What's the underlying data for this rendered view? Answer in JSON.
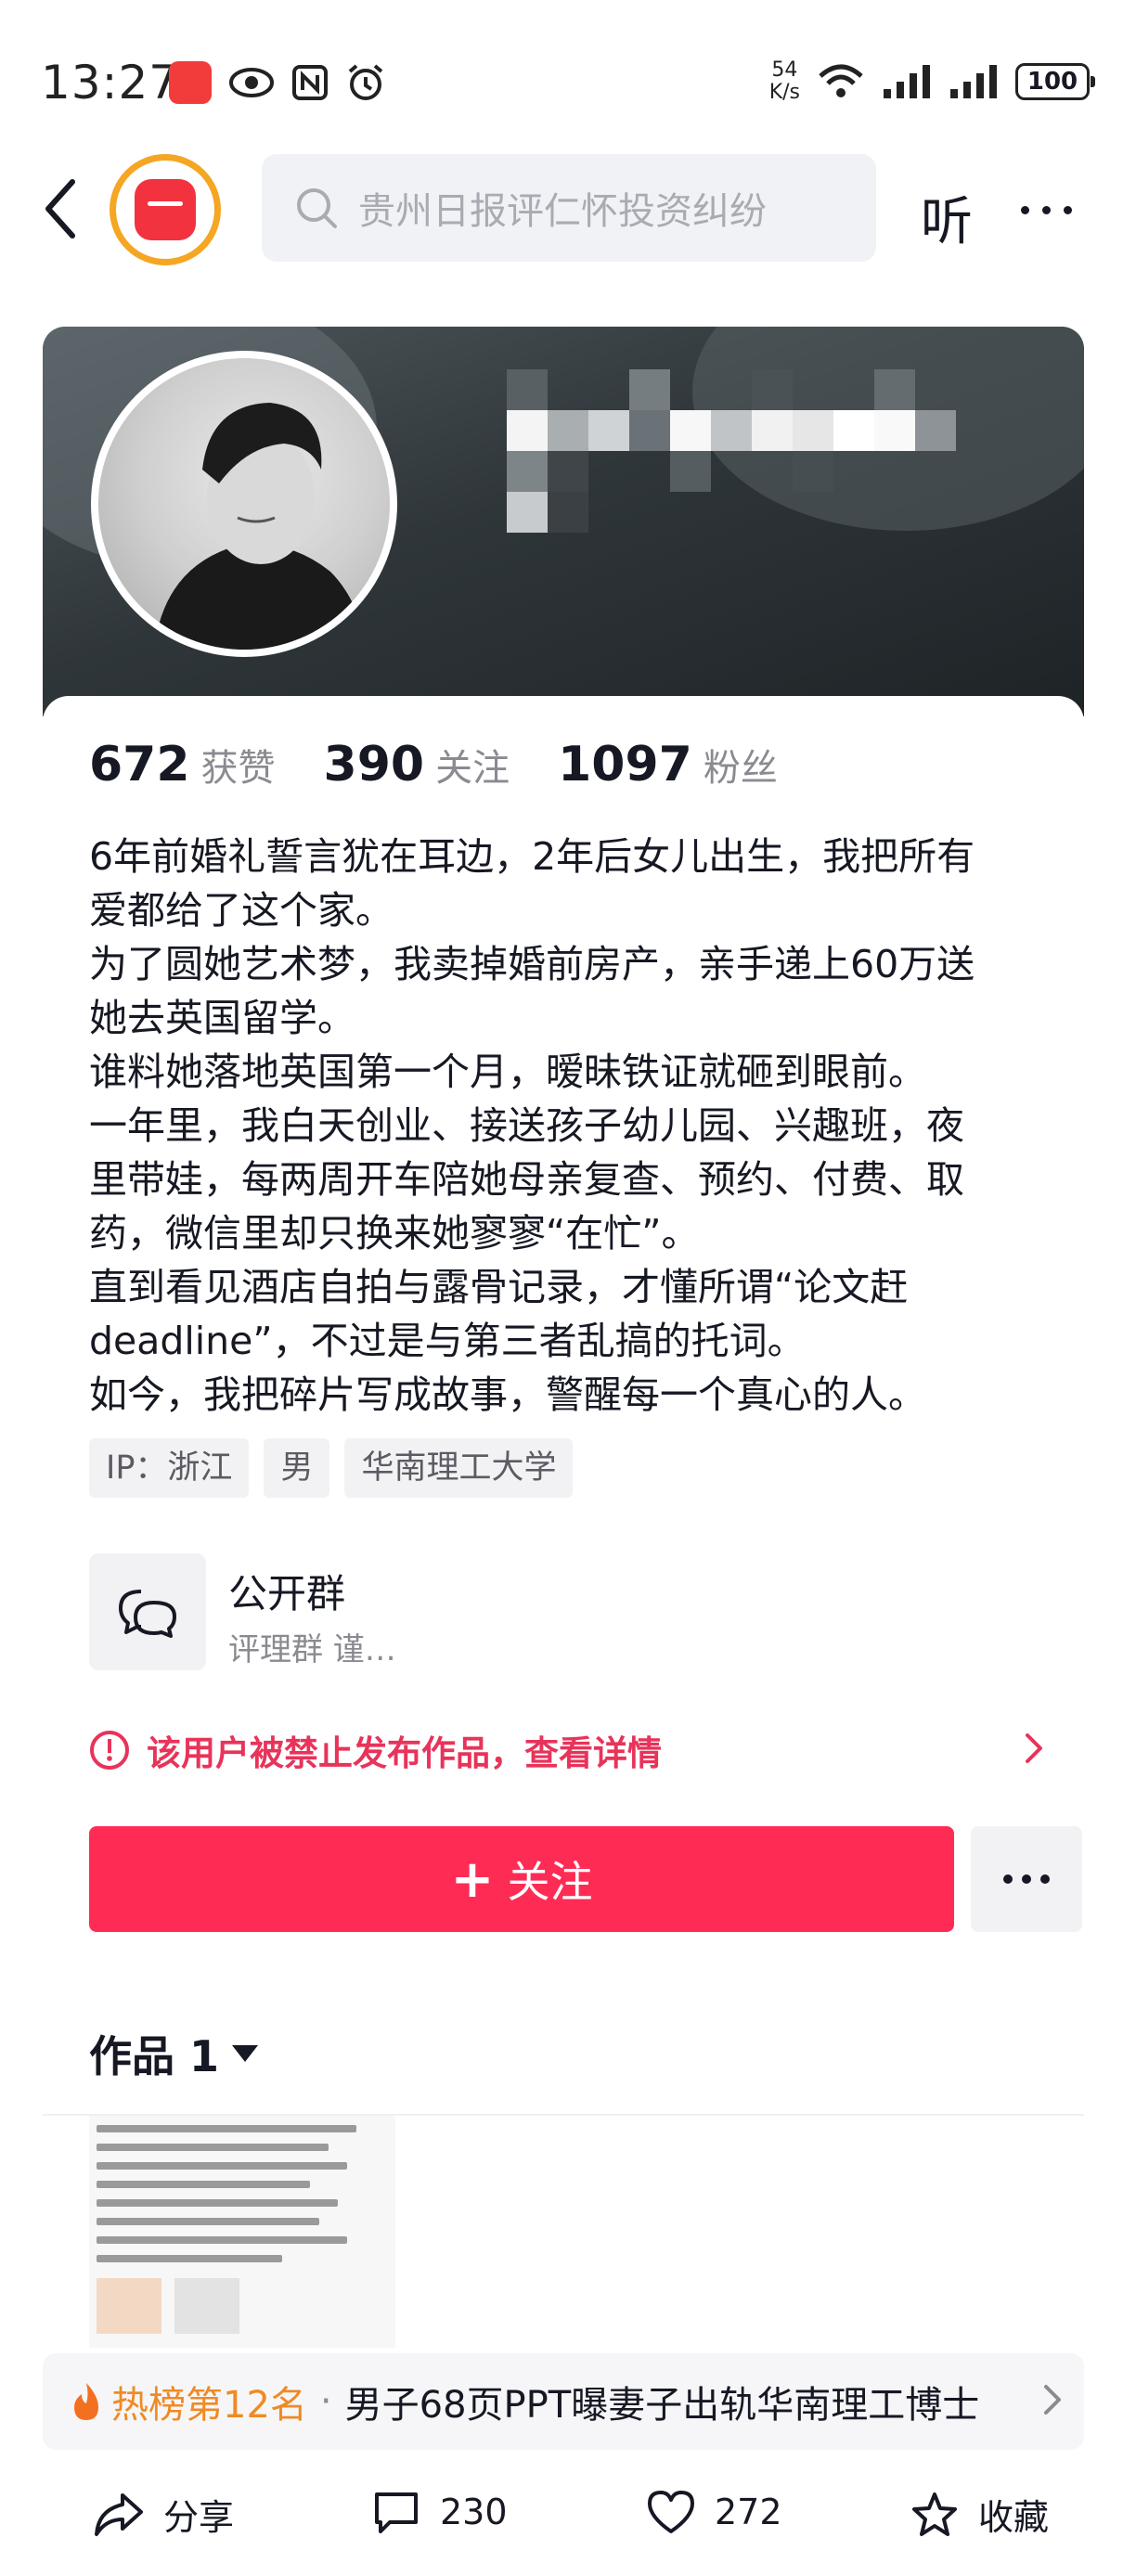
{
  "status_bar": {
    "time": "13:27",
    "net_speed_value": "54",
    "net_speed_unit": "K/s",
    "battery": "100"
  },
  "nav": {
    "search_placeholder": "贵州日报评仁怀投资纠纷",
    "listen_label": "听"
  },
  "profile": {
    "stats": [
      {
        "value": "672",
        "label": "获赞"
      },
      {
        "value": "390",
        "label": "关注"
      },
      {
        "value": "1097",
        "label": "粉丝"
      }
    ],
    "bio_lines": [
      "6年前婚礼誓言犹在耳边，2年后女儿出生，我把所有",
      "爱都给了这个家。",
      "为了圆她艺术梦，我卖掉婚前房产，亲手递上60万送",
      "她去英国留学。",
      "谁料她落地英国第一个月，暧昧铁证就砸到眼前。",
      "一年里，我白天创业、接送孩子幼儿园、兴趣班，夜",
      "里带娃，每两周开车陪她母亲复查、预约、付费、取",
      "药，微信里却只换来她寥寥“在忙”。",
      "直到看见酒店自拍与露骨记录，才懂所谓“论文赶",
      "deadline”，不过是与第三者乱搞的托词。",
      "如今，我把碎片写成故事，警醒每一个真心的人。"
    ],
    "tags": [
      "IP：浙江",
      "男",
      "华南理工大学"
    ],
    "group": {
      "title": "公开群",
      "subtitle": "评理群 谨…"
    },
    "ban_notice": "该用户被禁止发布作品，查看详情",
    "follow_label": "关注",
    "works_title": "作品 1"
  },
  "hot": {
    "rank": "热榜第12名",
    "separator": "·",
    "title": "男子68页PPT曝妻子出轨华南理工博士"
  },
  "bottom_bar": {
    "share": "分享",
    "comments": "230",
    "likes": "272",
    "favorite": "收藏"
  },
  "colors": {
    "accent": "#fe2c55",
    "ban_text": "#e8335a",
    "hot_rank": "#f08a24",
    "badge_ring": "#f5a623",
    "badge_fill": "#f2323f"
  }
}
